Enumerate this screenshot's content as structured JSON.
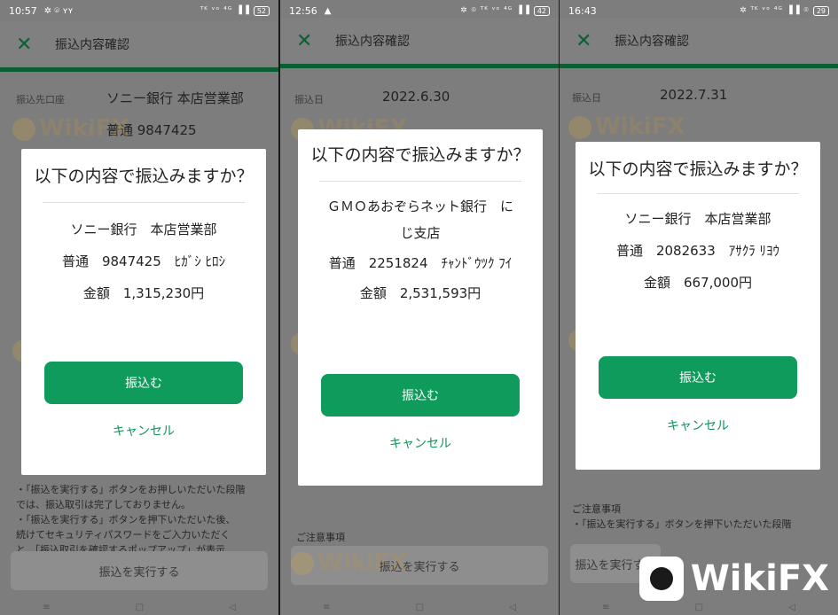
{
  "brand": {
    "logo_text": "WikiFX",
    "watermark_text": "WikiFX"
  },
  "colors": {
    "accent": "#0f9b5c",
    "appbar_border": "#0b5f35"
  },
  "phones": [
    {
      "status": {
        "time": "10:57",
        "icons": "✲ ⌾ ʏʏ",
        "right": "ᵀᴷ ᵛᵒ ⁴ᴳ ▐▐ ",
        "battery": "52"
      },
      "appbar": {
        "close_icon": "✕",
        "title": "振込内容確認"
      },
      "rows": [
        {
          "label": "振込先口座",
          "value": "ソニー銀行 本店営業部"
        },
        {
          "label": "",
          "value": "普通 9847425"
        }
      ],
      "dialog": {
        "title": "以下の内容で振込みますか？",
        "lines": [
          "ソニー銀行　本店営業部",
          "普通　9847425　ﾋｶﾞｼ ﾋﾛｼ",
          "金額　1,315,230円"
        ],
        "ok_label": "振込む",
        "cancel_label": "キャンセル"
      },
      "bg_notes": [
        "・「振込を実行する」ボタンをお押しいただいた段階",
        "では、振込取引は完了しておりません。",
        "・「振込を実行する」ボタンを押下いただいた後、",
        "続けてセキュリティパスワードをご入力いただく",
        "と、「振込取引を確認するポップアップ」が表示"
      ],
      "bottom_button": "振込を実行する"
    },
    {
      "status": {
        "time": "12:56",
        "icons": "▲",
        "right": "✲ ⌾ ᵀᴷ ᵛᵒ ⁴ᴳ ▐▐",
        "battery": "42"
      },
      "appbar": {
        "close_icon": "✕",
        "title": "振込内容確認"
      },
      "rows": [
        {
          "label": "振込日",
          "value": "2022.6.30"
        }
      ],
      "dialog": {
        "title": "以下の内容で振込みますか？",
        "lines": [
          "ＧＭＯあおぞらネット銀行　に",
          "じ支店",
          "普通　2251824　ﾁｬﾝﾄﾞｳﾂｸ ﾌｲ",
          "金額　2,531,593円"
        ],
        "ok_label": "振込む",
        "cancel_label": "キャンセル"
      },
      "bg_notes": [
        "ご注意事項"
      ],
      "bottom_button": "振込を実行する"
    },
    {
      "status": {
        "time": "16:43",
        "icons": "",
        "right": "✲ ᵀᴷ ᵛᵒ ⁴ᴳ ▐▐ ⌾",
        "battery": "29"
      },
      "appbar": {
        "close_icon": "✕",
        "title": "振込内容確認"
      },
      "rows": [
        {
          "label": "振込日",
          "value": "2022.7.31"
        }
      ],
      "dialog": {
        "title": "以下の内容で振込みますか？",
        "lines": [
          "ソニー銀行　本店営業部",
          "普通　2082633　ｱｻｸﾗ ﾘﾖｳ",
          "金額　667,000円"
        ],
        "ok_label": "振込む",
        "cancel_label": "キャンセル"
      },
      "bg_notes": [
        "ご注意事項",
        "・「振込を実行する」ボタンを押下いただいた段階"
      ],
      "bottom_button": "振込を実行する"
    }
  ]
}
